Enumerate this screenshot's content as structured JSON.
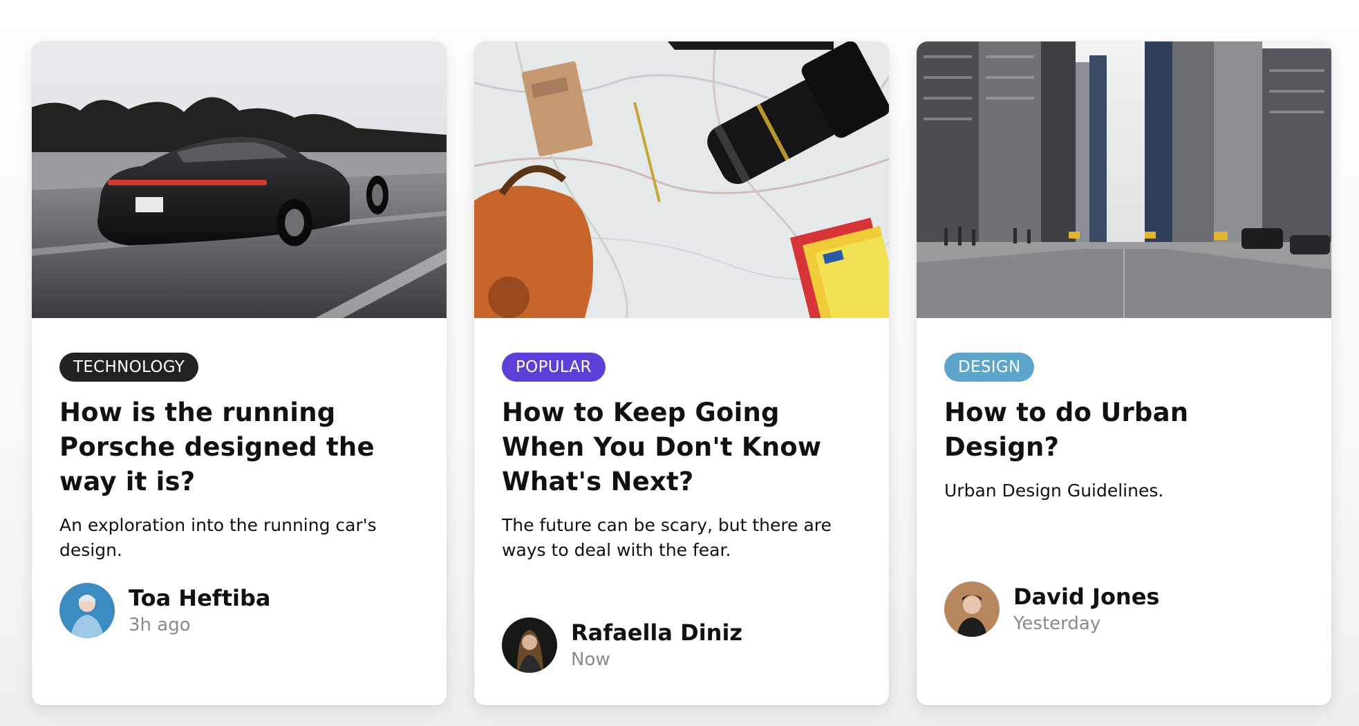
{
  "colors": {
    "tag_technology": "#222222",
    "tag_popular": "#5b3fd6",
    "tag_design": "#5ea5cb",
    "time_text": "#8a8a8a"
  },
  "cards": [
    {
      "image": "porsche-car-photo",
      "tag": "TECHNOLOGY",
      "title": "How is the running Porsche designed the way it is?",
      "description": "An exploration into the running car's design.",
      "author": {
        "avatar": "toa-heftiba-avatar",
        "name": "Toa Heftiba",
        "time": "3h ago"
      }
    },
    {
      "image": "travel-map-camera-photo",
      "tag": "POPULAR",
      "title": "How to Keep Going When You Don't Know What's Next?",
      "description": "The future can be scary, but there are ways to deal with the fear.",
      "author": {
        "avatar": "rafaella-diniz-avatar",
        "name": "Rafaella Diniz",
        "time": "Now"
      }
    },
    {
      "image": "city-street-photo",
      "tag": "DESIGN",
      "title": "How to do Urban Design?",
      "description": "Urban Design Guidelines.",
      "author": {
        "avatar": "david-jones-avatar",
        "name": "David Jones",
        "time": "Yesterday"
      }
    }
  ]
}
